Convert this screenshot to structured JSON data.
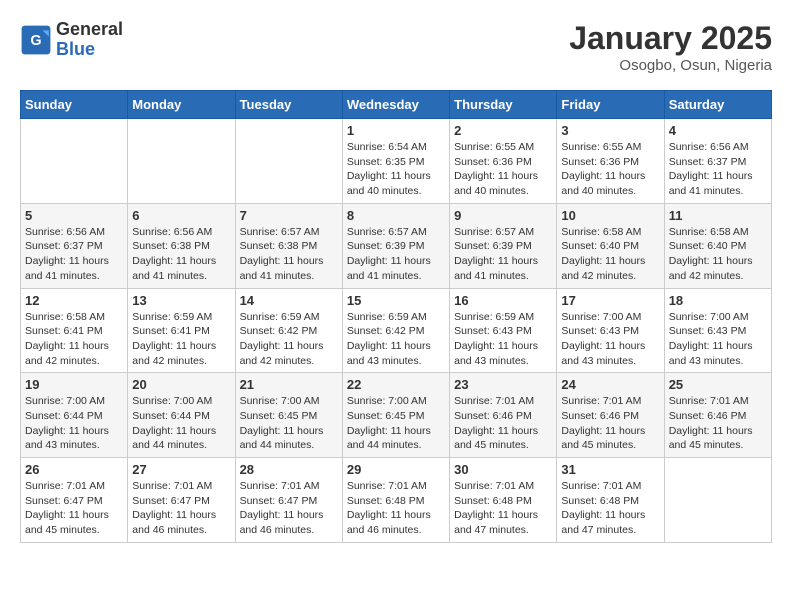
{
  "header": {
    "logo_general": "General",
    "logo_blue": "Blue",
    "month_title": "January 2025",
    "location": "Osogbo, Osun, Nigeria"
  },
  "days_of_week": [
    "Sunday",
    "Monday",
    "Tuesday",
    "Wednesday",
    "Thursday",
    "Friday",
    "Saturday"
  ],
  "weeks": [
    [
      {
        "day": "",
        "sunrise": "",
        "sunset": "",
        "daylight": ""
      },
      {
        "day": "",
        "sunrise": "",
        "sunset": "",
        "daylight": ""
      },
      {
        "day": "",
        "sunrise": "",
        "sunset": "",
        "daylight": ""
      },
      {
        "day": "1",
        "sunrise": "Sunrise: 6:54 AM",
        "sunset": "Sunset: 6:35 PM",
        "daylight": "Daylight: 11 hours and 40 minutes."
      },
      {
        "day": "2",
        "sunrise": "Sunrise: 6:55 AM",
        "sunset": "Sunset: 6:36 PM",
        "daylight": "Daylight: 11 hours and 40 minutes."
      },
      {
        "day": "3",
        "sunrise": "Sunrise: 6:55 AM",
        "sunset": "Sunset: 6:36 PM",
        "daylight": "Daylight: 11 hours and 40 minutes."
      },
      {
        "day": "4",
        "sunrise": "Sunrise: 6:56 AM",
        "sunset": "Sunset: 6:37 PM",
        "daylight": "Daylight: 11 hours and 41 minutes."
      }
    ],
    [
      {
        "day": "5",
        "sunrise": "Sunrise: 6:56 AM",
        "sunset": "Sunset: 6:37 PM",
        "daylight": "Daylight: 11 hours and 41 minutes."
      },
      {
        "day": "6",
        "sunrise": "Sunrise: 6:56 AM",
        "sunset": "Sunset: 6:38 PM",
        "daylight": "Daylight: 11 hours and 41 minutes."
      },
      {
        "day": "7",
        "sunrise": "Sunrise: 6:57 AM",
        "sunset": "Sunset: 6:38 PM",
        "daylight": "Daylight: 11 hours and 41 minutes."
      },
      {
        "day": "8",
        "sunrise": "Sunrise: 6:57 AM",
        "sunset": "Sunset: 6:39 PM",
        "daylight": "Daylight: 11 hours and 41 minutes."
      },
      {
        "day": "9",
        "sunrise": "Sunrise: 6:57 AM",
        "sunset": "Sunset: 6:39 PM",
        "daylight": "Daylight: 11 hours and 41 minutes."
      },
      {
        "day": "10",
        "sunrise": "Sunrise: 6:58 AM",
        "sunset": "Sunset: 6:40 PM",
        "daylight": "Daylight: 11 hours and 42 minutes."
      },
      {
        "day": "11",
        "sunrise": "Sunrise: 6:58 AM",
        "sunset": "Sunset: 6:40 PM",
        "daylight": "Daylight: 11 hours and 42 minutes."
      }
    ],
    [
      {
        "day": "12",
        "sunrise": "Sunrise: 6:58 AM",
        "sunset": "Sunset: 6:41 PM",
        "daylight": "Daylight: 11 hours and 42 minutes."
      },
      {
        "day": "13",
        "sunrise": "Sunrise: 6:59 AM",
        "sunset": "Sunset: 6:41 PM",
        "daylight": "Daylight: 11 hours and 42 minutes."
      },
      {
        "day": "14",
        "sunrise": "Sunrise: 6:59 AM",
        "sunset": "Sunset: 6:42 PM",
        "daylight": "Daylight: 11 hours and 42 minutes."
      },
      {
        "day": "15",
        "sunrise": "Sunrise: 6:59 AM",
        "sunset": "Sunset: 6:42 PM",
        "daylight": "Daylight: 11 hours and 43 minutes."
      },
      {
        "day": "16",
        "sunrise": "Sunrise: 6:59 AM",
        "sunset": "Sunset: 6:43 PM",
        "daylight": "Daylight: 11 hours and 43 minutes."
      },
      {
        "day": "17",
        "sunrise": "Sunrise: 7:00 AM",
        "sunset": "Sunset: 6:43 PM",
        "daylight": "Daylight: 11 hours and 43 minutes."
      },
      {
        "day": "18",
        "sunrise": "Sunrise: 7:00 AM",
        "sunset": "Sunset: 6:43 PM",
        "daylight": "Daylight: 11 hours and 43 minutes."
      }
    ],
    [
      {
        "day": "19",
        "sunrise": "Sunrise: 7:00 AM",
        "sunset": "Sunset: 6:44 PM",
        "daylight": "Daylight: 11 hours and 43 minutes."
      },
      {
        "day": "20",
        "sunrise": "Sunrise: 7:00 AM",
        "sunset": "Sunset: 6:44 PM",
        "daylight": "Daylight: 11 hours and 44 minutes."
      },
      {
        "day": "21",
        "sunrise": "Sunrise: 7:00 AM",
        "sunset": "Sunset: 6:45 PM",
        "daylight": "Daylight: 11 hours and 44 minutes."
      },
      {
        "day": "22",
        "sunrise": "Sunrise: 7:00 AM",
        "sunset": "Sunset: 6:45 PM",
        "daylight": "Daylight: 11 hours and 44 minutes."
      },
      {
        "day": "23",
        "sunrise": "Sunrise: 7:01 AM",
        "sunset": "Sunset: 6:46 PM",
        "daylight": "Daylight: 11 hours and 45 minutes."
      },
      {
        "day": "24",
        "sunrise": "Sunrise: 7:01 AM",
        "sunset": "Sunset: 6:46 PM",
        "daylight": "Daylight: 11 hours and 45 minutes."
      },
      {
        "day": "25",
        "sunrise": "Sunrise: 7:01 AM",
        "sunset": "Sunset: 6:46 PM",
        "daylight": "Daylight: 11 hours and 45 minutes."
      }
    ],
    [
      {
        "day": "26",
        "sunrise": "Sunrise: 7:01 AM",
        "sunset": "Sunset: 6:47 PM",
        "daylight": "Daylight: 11 hours and 45 minutes."
      },
      {
        "day": "27",
        "sunrise": "Sunrise: 7:01 AM",
        "sunset": "Sunset: 6:47 PM",
        "daylight": "Daylight: 11 hours and 46 minutes."
      },
      {
        "day": "28",
        "sunrise": "Sunrise: 7:01 AM",
        "sunset": "Sunset: 6:47 PM",
        "daylight": "Daylight: 11 hours and 46 minutes."
      },
      {
        "day": "29",
        "sunrise": "Sunrise: 7:01 AM",
        "sunset": "Sunset: 6:48 PM",
        "daylight": "Daylight: 11 hours and 46 minutes."
      },
      {
        "day": "30",
        "sunrise": "Sunrise: 7:01 AM",
        "sunset": "Sunset: 6:48 PM",
        "daylight": "Daylight: 11 hours and 47 minutes."
      },
      {
        "day": "31",
        "sunrise": "Sunrise: 7:01 AM",
        "sunset": "Sunset: 6:48 PM",
        "daylight": "Daylight: 11 hours and 47 minutes."
      },
      {
        "day": "",
        "sunrise": "",
        "sunset": "",
        "daylight": ""
      }
    ]
  ]
}
